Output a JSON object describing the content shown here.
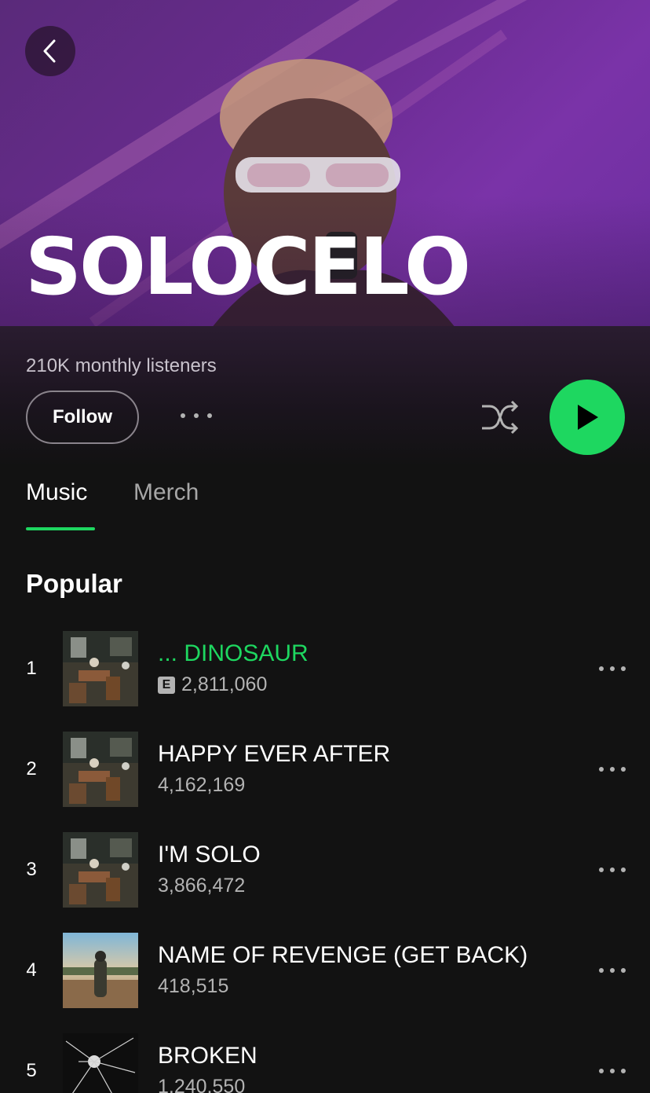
{
  "artist": {
    "name": "SOLOCELO",
    "monthly_listeners": "210K monthly listeners"
  },
  "actions": {
    "follow_label": "Follow"
  },
  "tabs": [
    {
      "label": "Music",
      "active": true
    },
    {
      "label": "Merch",
      "active": false
    }
  ],
  "popular": {
    "title": "Popular",
    "tracks": [
      {
        "rank": "1",
        "title": "... DINOSAUR",
        "plays": "2,811,060",
        "explicit": "E",
        "playing": true
      },
      {
        "rank": "2",
        "title": "HAPPY EVER AFTER",
        "plays": "4,162,169",
        "explicit": null,
        "playing": false
      },
      {
        "rank": "3",
        "title": "I'M SOLO",
        "plays": "3,866,472",
        "explicit": null,
        "playing": false
      },
      {
        "rank": "4",
        "title": "NAME OF REVENGE (GET BACK)",
        "plays": "418,515",
        "explicit": null,
        "playing": false
      },
      {
        "rank": "5",
        "title": "BROKEN",
        "plays": "1,240,550",
        "explicit": null,
        "playing": false
      }
    ]
  },
  "colors": {
    "accent": "#1ed760",
    "background": "#121212",
    "secondary_text": "#b3b3b3"
  },
  "icons": [
    "chevron-left-icon",
    "more-icon",
    "shuffle-icon",
    "play-icon",
    "explicit-badge"
  ]
}
